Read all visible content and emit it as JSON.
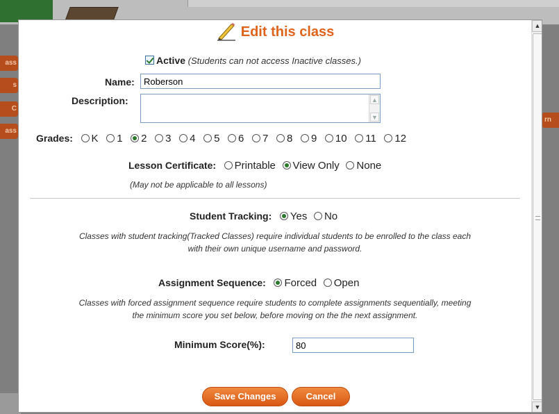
{
  "background": {
    "tabs": [
      "ass",
      "s",
      "C",
      "ass"
    ],
    "right_tab": "rn"
  },
  "dialog": {
    "title": "Edit this class",
    "active": {
      "label": "Active",
      "note": "(Students can not access Inactive classes.)",
      "checked": true
    },
    "name": {
      "label": "Name:",
      "value": "Roberson"
    },
    "description": {
      "label": "Description:",
      "value": ""
    },
    "grades": {
      "label": "Grades:",
      "options": [
        "K",
        "1",
        "2",
        "3",
        "4",
        "5",
        "6",
        "7",
        "8",
        "9",
        "10",
        "11",
        "12"
      ],
      "selected": "2"
    },
    "certificate": {
      "label": "Lesson Certificate:",
      "options": [
        "Printable",
        "View Only",
        "None"
      ],
      "selected": "View Only",
      "note": "(May not be applicable to all lessons)"
    },
    "tracking": {
      "label": "Student Tracking:",
      "options": [
        "Yes",
        "No"
      ],
      "selected": "Yes",
      "note_line1": "Classes with student tracking(Tracked Classes) require individual students to be enrolled to the class each",
      "note_line2": "with their own unique username and password."
    },
    "sequence": {
      "label": "Assignment Sequence:",
      "options": [
        "Forced",
        "Open"
      ],
      "selected": "Forced",
      "note_line1": "Classes with forced assignment sequence require students to complete assignments sequentially, meeting",
      "note_line2": "the minimum score you set below, before moving on the the next assignment."
    },
    "min_score": {
      "label": "Minimum Score(%):",
      "value": "80"
    },
    "buttons": {
      "save": "Save Changes",
      "cancel": "Cancel"
    }
  },
  "colors": {
    "accent": "#e0631c",
    "button": "#e56a22",
    "radio_dot": "#2a7a2a"
  }
}
